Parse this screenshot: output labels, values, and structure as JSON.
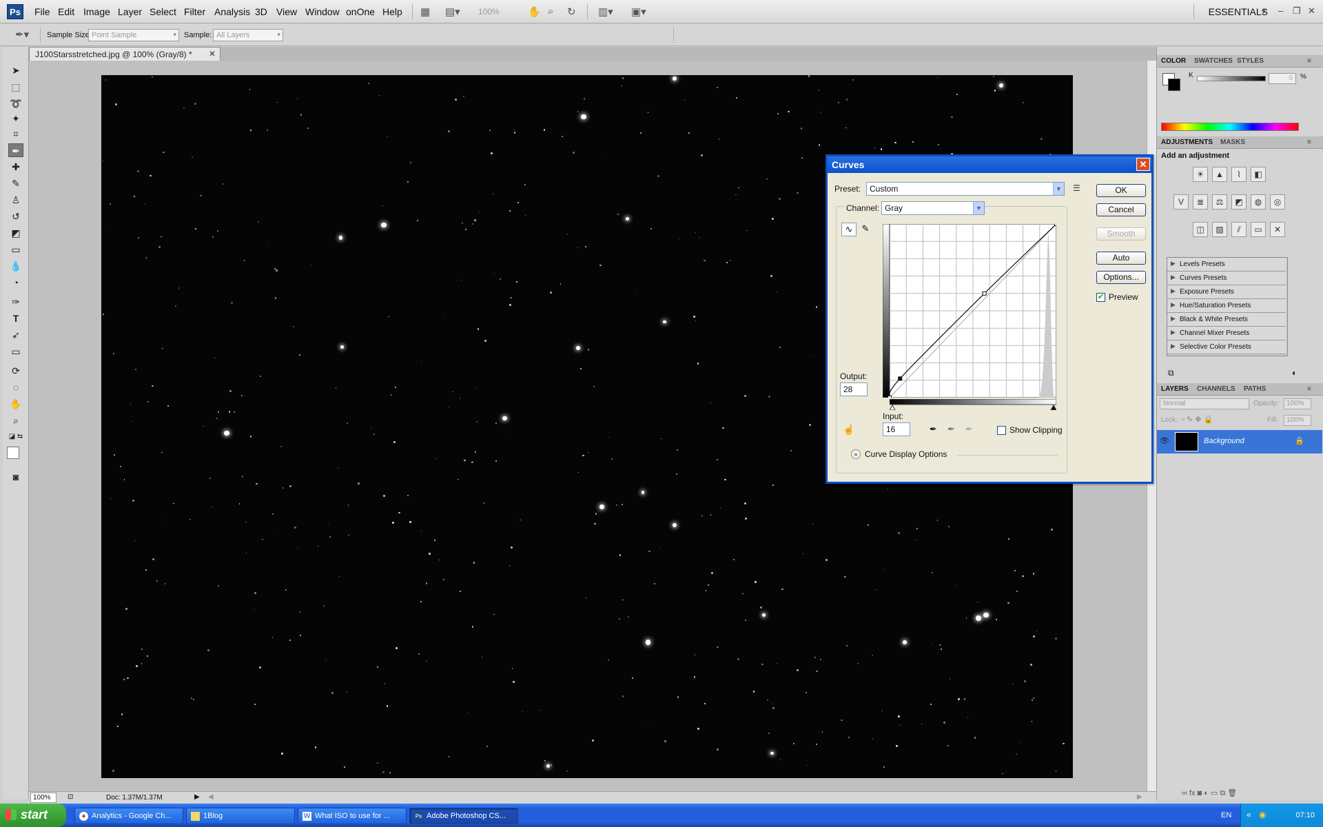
{
  "menubar": {
    "logo": "Ps",
    "items": [
      "File",
      "Edit",
      "Image",
      "Layer",
      "Select",
      "Filter",
      "Analysis",
      "3D",
      "View",
      "Window",
      "onOne",
      "Help"
    ],
    "zoom": "100%",
    "workspace": "ESSENTIALS"
  },
  "options": {
    "sample_size_label": "Sample Size:",
    "sample_size_value": "Point Sample",
    "sample_label": "Sample:",
    "sample_value": "All Layers"
  },
  "document": {
    "tab_title": "J100Starsstretched.jpg @ 100% (Gray/8) *",
    "zoom": "100%",
    "doc_size": "Doc: 1.37M/1.37M"
  },
  "panels": {
    "color_tabs": [
      "COLOR",
      "SWATCHES",
      "STYLES"
    ],
    "k_label": "K",
    "k_value": "0",
    "k_unit": "%",
    "adjustments_tabs": [
      "ADJUSTMENTS",
      "MASKS"
    ],
    "add_adjustment": "Add an adjustment",
    "presets": [
      "Levels Presets",
      "Curves Presets",
      "Exposure Presets",
      "Hue/Saturation Presets",
      "Black & White Presets",
      "Channel Mixer Presets",
      "Selective Color Presets"
    ],
    "layers_tabs": [
      "LAYERS",
      "CHANNELS",
      "PATHS"
    ],
    "blend_mode": "Normal",
    "opacity_label": "Opacity:",
    "opacity_value": "100%",
    "lock_label": "Lock:",
    "fill_label": "Fill:",
    "fill_value": "100%",
    "layer_name": "Background"
  },
  "curves": {
    "title": "Curves",
    "preset_label": "Preset:",
    "preset_value": "Custom",
    "channel_label": "Channel:",
    "channel_value": "Gray",
    "output_label": "Output:",
    "output_value": "28",
    "input_label": "Input:",
    "input_value": "16",
    "show_clipping": "Show Clipping",
    "show_clipping_checked": false,
    "curve_display_options": "Curve Display Options",
    "buttons": {
      "ok": "OK",
      "cancel": "Cancel",
      "smooth": "Smooth",
      "auto": "Auto",
      "options": "Options..."
    },
    "preview_label": "Preview",
    "preview_checked": true,
    "curve_points": [
      [
        0,
        0
      ],
      [
        16,
        28
      ],
      [
        145,
        153
      ],
      [
        255,
        255
      ]
    ]
  },
  "taskbar": {
    "start": "start",
    "tasks": [
      "Analytics - Google Ch...",
      "1Blog",
      "What ISO to use for ...",
      "Adobe Photoshop CS..."
    ],
    "language": "EN",
    "clock": "07:10"
  },
  "colors": {
    "selection_blue": "#3875d7",
    "xp_title_blue": "#0b52c9",
    "taskbar_blue": "#245edc",
    "start_green": "#3a9c37"
  }
}
